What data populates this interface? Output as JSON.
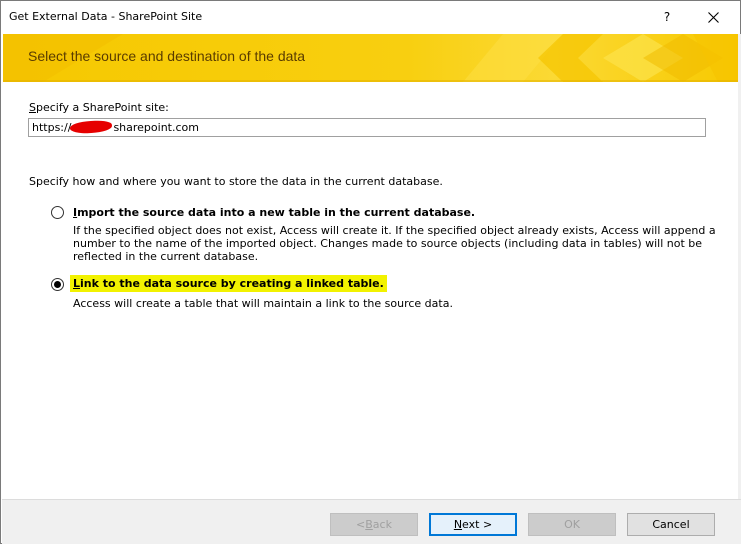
{
  "window": {
    "title": "Get External Data - SharePoint Site",
    "help_label": "?",
    "close_icon": "close-icon"
  },
  "banner": {
    "title": "Select the source and destination of the data",
    "accent_color": "#f6c800",
    "text_color": "#5a3c00"
  },
  "site": {
    "label_underlined": "S",
    "label_rest": "pecify a SharePoint site:",
    "value_prefix": "https://",
    "value_suffix": "sharepoint.com"
  },
  "storage": {
    "prompt": "Specify how and where you want to store the data in the current database.",
    "options": [
      {
        "label_underlined": "I",
        "label_rest": "mport the source data into a new table in the current database.",
        "selected": false,
        "description_lines": [
          "If the specified object does not exist, Access will create it. If the specified object already exists, Access will append a",
          "number to the name of the imported object. Changes made to source objects (including data in tables) will not be",
          "reflected in the current database."
        ]
      },
      {
        "label_underlined": "L",
        "label_rest": "ink to the data source by creating a linked table.",
        "selected": true,
        "description_lines": [
          "Access will create a table that will maintain a link to the source data."
        ]
      }
    ]
  },
  "footer": {
    "back_label_prefix": "< ",
    "back_label_underlined": "B",
    "back_label_rest": "ack",
    "next_label_underlined": "N",
    "next_label_rest": "ext >",
    "ok_label": "OK",
    "cancel_label": "Cancel"
  }
}
